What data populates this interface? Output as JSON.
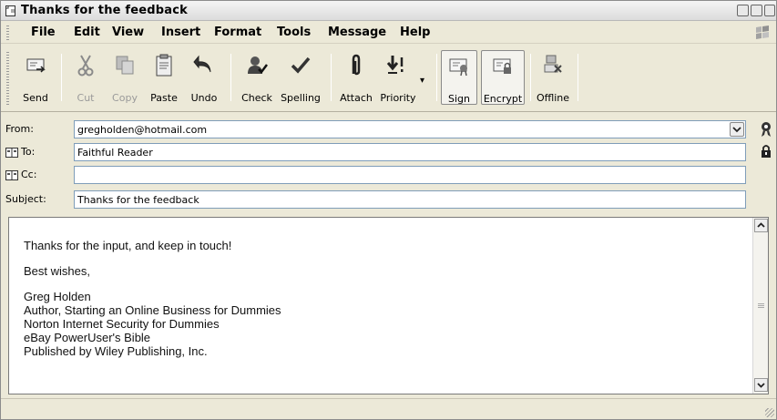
{
  "window": {
    "title": "Thanks for the feedback"
  },
  "menu": {
    "items": [
      "File",
      "Edit",
      "View",
      "Insert",
      "Format",
      "Tools",
      "Message",
      "Help"
    ]
  },
  "toolbar": {
    "buttons": [
      {
        "label": "Send",
        "icon": "send-icon",
        "enabled": true
      },
      {
        "label": "Cut",
        "icon": "scissors-icon",
        "enabled": false
      },
      {
        "label": "Copy",
        "icon": "copy-icon",
        "enabled": false
      },
      {
        "label": "Paste",
        "icon": "clipboard-icon",
        "enabled": true
      },
      {
        "label": "Undo",
        "icon": "undo-arrow-icon",
        "enabled": true
      },
      {
        "label": "Check",
        "icon": "check-names-icon",
        "enabled": true
      },
      {
        "label": "Spelling",
        "icon": "checkmark-icon",
        "enabled": true
      },
      {
        "label": "Attach",
        "icon": "paperclip-icon",
        "enabled": true
      },
      {
        "label": "Priority",
        "icon": "priority-arrow-icon",
        "enabled": true
      },
      {
        "label": "Sign",
        "icon": "sign-certificate-icon",
        "enabled": true,
        "toggled": true
      },
      {
        "label": "Encrypt",
        "icon": "encrypt-lock-icon",
        "enabled": true,
        "toggled": true
      },
      {
        "label": "Offline",
        "icon": "offline-icon",
        "enabled": true
      }
    ]
  },
  "header": {
    "from": {
      "label": "From:",
      "value": "gregholden@hotmail.com"
    },
    "to": {
      "label": "To:",
      "value": "Faithful Reader"
    },
    "cc": {
      "label": "Cc:",
      "value": ""
    },
    "subject": {
      "label": "Subject:",
      "value": "Thanks for the feedback"
    }
  },
  "body": {
    "lines": [
      "Thanks for the input, and keep in touch!",
      "Best wishes,",
      "Greg Holden",
      "Author, Starting an Online Business for Dummies",
      "Norton Internet Security for Dummies",
      "eBay PowerUser's Bible",
      "Published by Wiley Publishing, Inc."
    ]
  },
  "colors": {
    "chrome": "#ece9d8",
    "field_border": "#7f9db9",
    "disabled_text": "#9a9a9a"
  }
}
